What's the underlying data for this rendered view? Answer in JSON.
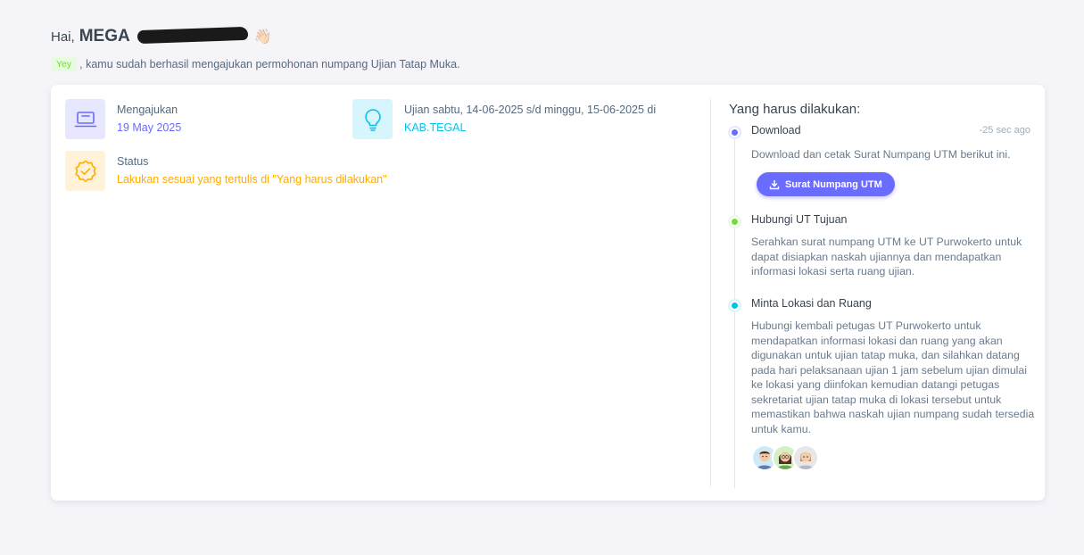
{
  "greeting": {
    "hai": "Hai,",
    "name": "MEGA",
    "wave": "👋🏻"
  },
  "subline": {
    "badge": "Yey",
    "text": ", kamu sudah berhasil mengajukan permohonan numpang Ujian Tatap Muka."
  },
  "info": {
    "submitted_label": "Mengajukan",
    "submitted_value": "19 May 2025",
    "exam_label": "Ujian sabtu, 14-06-2025 s/d minggu, 15-06-2025 di",
    "exam_value": "KAB.TEGAL",
    "status_label": "Status",
    "status_value": "Lakukan sesuai yang tertulis di \"Yang harus dilakukan\""
  },
  "todo": {
    "title": "Yang harus dilakukan:",
    "items": [
      {
        "title": "Download",
        "time": "-25 sec ago",
        "desc": "Download dan cetak Surat Numpang UTM berikut ini.",
        "button": "Surat Numpang UTM",
        "dot_color": "#696cff"
      },
      {
        "title": "Hubungi UT Tujuan",
        "desc": "Serahkan surat numpang UTM ke UT Purwokerto untuk dapat disiapkan naskah ujiannya dan mendapatkan informasi lokasi serta ruang ujian.",
        "dot_color": "#71dd37"
      },
      {
        "title": "Minta Lokasi dan Ruang",
        "desc": "Hubungi kembali petugas UT Purwokerto untuk mendapatkan informasi lokasi dan ruang yang akan digunakan untuk ujian tatap muka, dan silahkan datang pada hari pelaksanaan ujian 1 jam sebelum ujian dimulai ke lokasi yang diinfokan kemudian datangi petugas sekretariat ujian tatap muka di lokasi tersebut untuk memastikan bahwa naskah ujian numpang sudah tersedia untuk kamu.",
        "dot_color": "#03c3ec"
      }
    ]
  },
  "colors": {
    "primary": "#696cff",
    "info": "#03c3ec",
    "warning": "#ffab00",
    "success": "#71dd37"
  },
  "icons": {
    "submitted": "laptop-icon",
    "exam": "lightbulb-icon",
    "status": "badge-check-icon",
    "button": "download-icon"
  }
}
